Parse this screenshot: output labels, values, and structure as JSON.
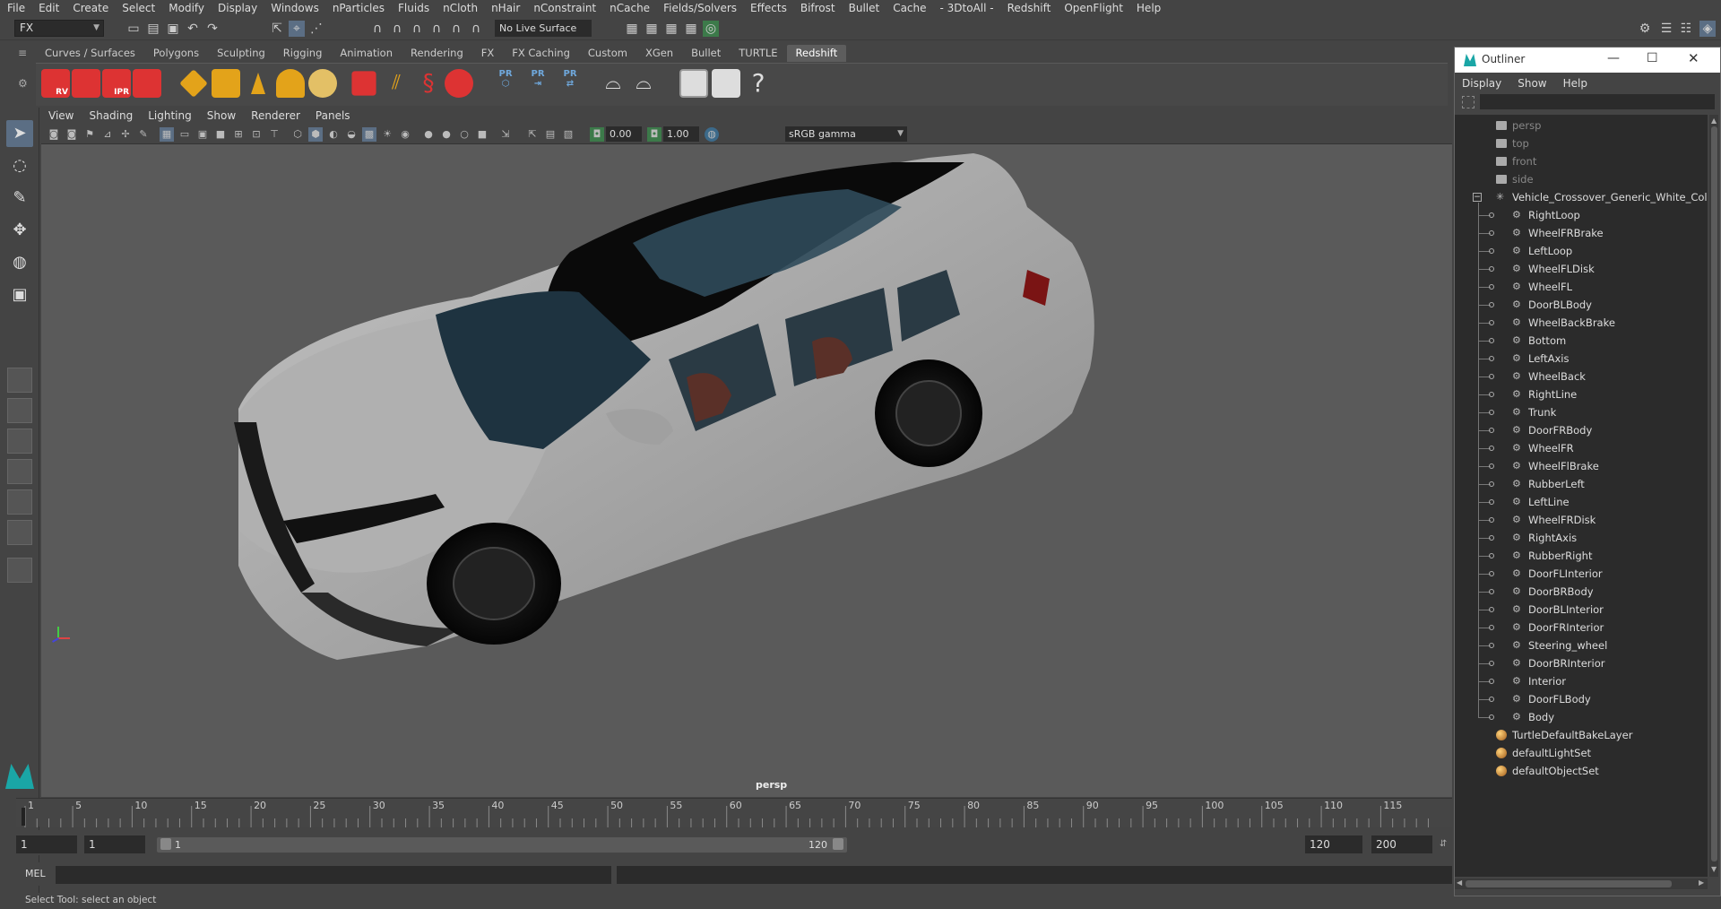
{
  "menubar": {
    "items": [
      "File",
      "Edit",
      "Create",
      "Select",
      "Modify",
      "Display",
      "Windows",
      "nParticles",
      "Fluids",
      "nCloth",
      "nHair",
      "nConstraint",
      "nCache",
      "Fields/Solvers",
      "Effects",
      "Bifrost",
      "Bullet",
      "Cache",
      "- 3DtoAll -",
      "Redshift",
      "OpenFlight",
      "Help"
    ]
  },
  "statusline": {
    "mode": "FX",
    "live_surface": "No Live Surface"
  },
  "shelf": {
    "tabs": [
      "Curves / Surfaces",
      "Polygons",
      "Sculpting",
      "Rigging",
      "Animation",
      "Rendering",
      "FX",
      "FX Caching",
      "Custom",
      "XGen",
      "Bullet",
      "TURTLE",
      "Redshift"
    ],
    "active_tab": "Redshift",
    "icon_labels": [
      "RV",
      "",
      "IPR",
      ""
    ]
  },
  "panel": {
    "menu": [
      "View",
      "Shading",
      "Lighting",
      "Show",
      "Renderer",
      "Panels"
    ],
    "exposure": "0.00",
    "gamma_value": "1.00",
    "color_space": "sRGB gamma",
    "camera_label": "persp"
  },
  "timeline": {
    "ticks": [
      "1",
      "5",
      "10",
      "15",
      "20",
      "25",
      "30",
      "35",
      "40",
      "45",
      "50",
      "55",
      "60",
      "65",
      "70",
      "75",
      "80",
      "85",
      "90",
      "95",
      "100",
      "105",
      "110",
      "115"
    ]
  },
  "range": {
    "start": "1",
    "playback_start": "1",
    "slider_start": "1",
    "slider_end": "120",
    "playback_end": "120",
    "end": "200"
  },
  "cmdline": {
    "label": "MEL"
  },
  "helpline": {
    "text": "Select Tool: select an object"
  },
  "outliner": {
    "title": "Outliner",
    "menu": [
      "Display",
      "Show",
      "Help"
    ],
    "cameras": [
      "persp",
      "top",
      "front",
      "side"
    ],
    "group": "Vehicle_Crossover_Generic_White_Color_",
    "children": [
      "RightLoop",
      "WheelFRBrake",
      "LeftLoop",
      "WheelFLDisk",
      "WheelFL",
      "DoorBLBody",
      "WheelBackBrake",
      "Bottom",
      "LeftAxis",
      "WheelBack",
      "RightLine",
      "Trunk",
      "DoorFRBody",
      "WheelFR",
      "WheelFlBrake",
      "RubberLeft",
      "LeftLine",
      "WheelFRDisk",
      "RightAxis",
      "RubberRight",
      "DoorFLInterior",
      "DoorBRBody",
      "DoorBLInterior",
      "DoorFRInterior",
      "Steering_wheel",
      "DoorBRInterior",
      "Interior",
      "DoorFLBody",
      "Body"
    ],
    "sets": [
      "TurtleDefaultBakeLayer",
      "defaultLightSet",
      "defaultObjectSet"
    ]
  },
  "colors": {
    "accent": "#5b6e84",
    "redshift_red": "#d33333",
    "viewport_bg": "#5a5a5a"
  }
}
